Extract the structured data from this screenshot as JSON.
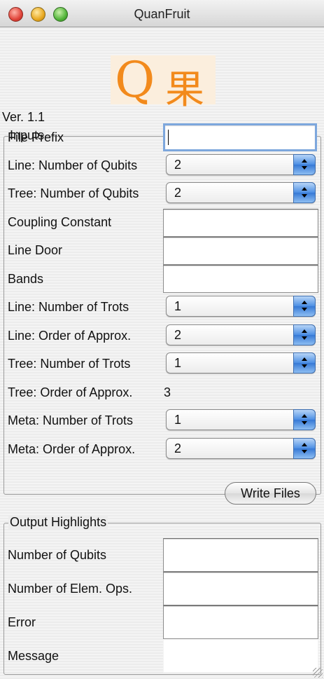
{
  "window": {
    "title": "QuanFruit"
  },
  "logo": {
    "letter": "Q",
    "kanji": "果"
  },
  "version": "Ver. 1.1",
  "inputs": {
    "legend": "Inputs",
    "file_prefix": {
      "label": "File Prefix",
      "value": ""
    },
    "line_qubits": {
      "label": "Line: Number of Qubits",
      "value": "2"
    },
    "tree_qubits": {
      "label": "Tree: Number of Qubits",
      "value": "2"
    },
    "coupling": {
      "label": "Coupling Constant",
      "value": ""
    },
    "line_door": {
      "label": "Line Door",
      "value": ""
    },
    "bands": {
      "label": "Bands",
      "value": ""
    },
    "line_trots": {
      "label": "Line: Number of Trots",
      "value": "1"
    },
    "line_order": {
      "label": "Line: Order of Approx.",
      "value": "2"
    },
    "tree_trots": {
      "label": "Tree: Number of Trots",
      "value": "1"
    },
    "tree_order": {
      "label": "Tree: Order of Approx.",
      "value": "3"
    },
    "meta_trots": {
      "label": "Meta: Number of Trots",
      "value": "1"
    },
    "meta_order": {
      "label": "Meta: Order of Approx.",
      "value": "2"
    }
  },
  "write_button": "Write Files",
  "output": {
    "legend": "Output Highlights",
    "num_qubits": "Number of Qubits",
    "num_elem_ops": "Number of Elem. Ops.",
    "error": "Error",
    "message": "Message"
  }
}
